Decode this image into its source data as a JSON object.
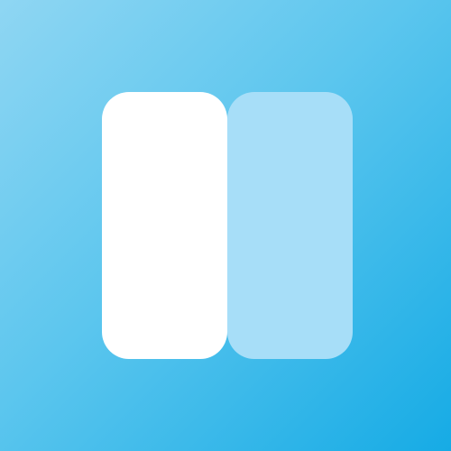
{
  "app_icon": {
    "name": "two-column-layout-icon",
    "colors": {
      "background_light": "#8fd6f3",
      "background_dark": "#16abe5",
      "left_panel": "#ffffff",
      "right_panel": "#a7def8"
    }
  }
}
